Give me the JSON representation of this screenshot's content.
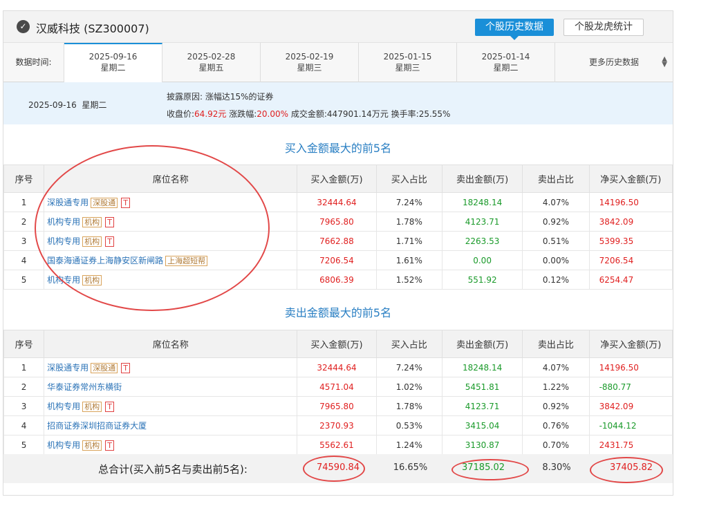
{
  "header": {
    "check_icon": "check-circle-icon",
    "title": "汉威科技 (SZ300007)",
    "history_btn": "个股历史数据",
    "lhb_btn": "个股龙虎统计"
  },
  "tabs": {
    "label": "数据时间:",
    "items": [
      {
        "date": "2025-09-16",
        "week": "星期二"
      },
      {
        "date": "2025-02-28",
        "week": "星期五"
      },
      {
        "date": "2025-02-19",
        "week": "星期三"
      },
      {
        "date": "2025-01-15",
        "week": "星期三"
      },
      {
        "date": "2025-01-14",
        "week": "星期二"
      }
    ],
    "more": "更多历史数据",
    "more_icon": "updown-caret-icon"
  },
  "info": {
    "date": "2025-09-16  星期二",
    "reason_label": "披露原因:",
    "reason": "涨幅达15%的证券",
    "close_label": "收盘价:",
    "close": "64.92元",
    "change_label": "涨跌幅:",
    "change": "20.00%",
    "volume_label": "成交金额:",
    "volume": "447901.14万元",
    "turnover_label": "换手率:",
    "turnover": "25.55%"
  },
  "columns": [
    "序号",
    "席位名称",
    "买入金额(万)",
    "买入占比",
    "卖出金额(万)",
    "卖出占比",
    "净买入金额(万)"
  ],
  "buy_section": {
    "title": "买入金额最大的前5名",
    "rows": [
      {
        "idx": "1",
        "name": "深股通专用",
        "tag": "深股通",
        "t": "T",
        "buy": "32444.64",
        "buy_pct": "7.24%",
        "sell": "18248.14",
        "sell_pct": "4.07%",
        "net": "14196.50"
      },
      {
        "idx": "2",
        "name": "机构专用",
        "tag": "机构",
        "t": "T",
        "buy": "7965.80",
        "buy_pct": "1.78%",
        "sell": "4123.71",
        "sell_pct": "0.92%",
        "net": "3842.09"
      },
      {
        "idx": "3",
        "name": "机构专用",
        "tag": "机构",
        "t": "T",
        "buy": "7662.88",
        "buy_pct": "1.71%",
        "sell": "2263.53",
        "sell_pct": "0.51%",
        "net": "5399.35"
      },
      {
        "idx": "4",
        "name": "国泰海通证券上海静安区新闸路",
        "tag": "上海超短帮",
        "t": "",
        "buy": "7206.54",
        "buy_pct": "1.61%",
        "sell": "0.00",
        "sell_pct": "0.00%",
        "net": "7206.54"
      },
      {
        "idx": "5",
        "name": "机构专用",
        "tag": "机构",
        "t": "",
        "buy": "6806.39",
        "buy_pct": "1.52%",
        "sell": "551.92",
        "sell_pct": "0.12%",
        "net": "6254.47"
      }
    ]
  },
  "sell_section": {
    "title": "卖出金额最大的前5名",
    "rows": [
      {
        "idx": "1",
        "name": "深股通专用",
        "tag": "深股通",
        "t": "T",
        "buy": "32444.64",
        "buy_pct": "7.24%",
        "sell": "18248.14",
        "sell_pct": "4.07%",
        "net": "14196.50"
      },
      {
        "idx": "2",
        "name": "华泰证券常州东横街",
        "tag": "",
        "t": "",
        "buy": "4571.04",
        "buy_pct": "1.02%",
        "sell": "5451.81",
        "sell_pct": "1.22%",
        "net": "-880.77"
      },
      {
        "idx": "3",
        "name": "机构专用",
        "tag": "机构",
        "t": "T",
        "buy": "7965.80",
        "buy_pct": "1.78%",
        "sell": "4123.71",
        "sell_pct": "0.92%",
        "net": "3842.09"
      },
      {
        "idx": "4",
        "name": "招商证券深圳招商证券大厦",
        "tag": "",
        "t": "",
        "buy": "2370.93",
        "buy_pct": "0.53%",
        "sell": "3415.04",
        "sell_pct": "0.76%",
        "net": "-1044.12"
      },
      {
        "idx": "5",
        "name": "机构专用",
        "tag": "机构",
        "t": "T",
        "buy": "5562.61",
        "buy_pct": "1.24%",
        "sell": "3130.87",
        "sell_pct": "0.70%",
        "net": "2431.75"
      }
    ]
  },
  "total": {
    "label": "总合计(买入前5名与卖出前5名):",
    "buy": "74590.84",
    "buy_pct": "16.65%",
    "sell": "37185.02",
    "sell_pct": "8.30%",
    "net": "37405.82"
  },
  "colors": {
    "accent": "#1a8fd8",
    "up": "#e02020",
    "down": "#1a9a2a",
    "link": "#2b73b7",
    "annotation": "#e24848"
  }
}
